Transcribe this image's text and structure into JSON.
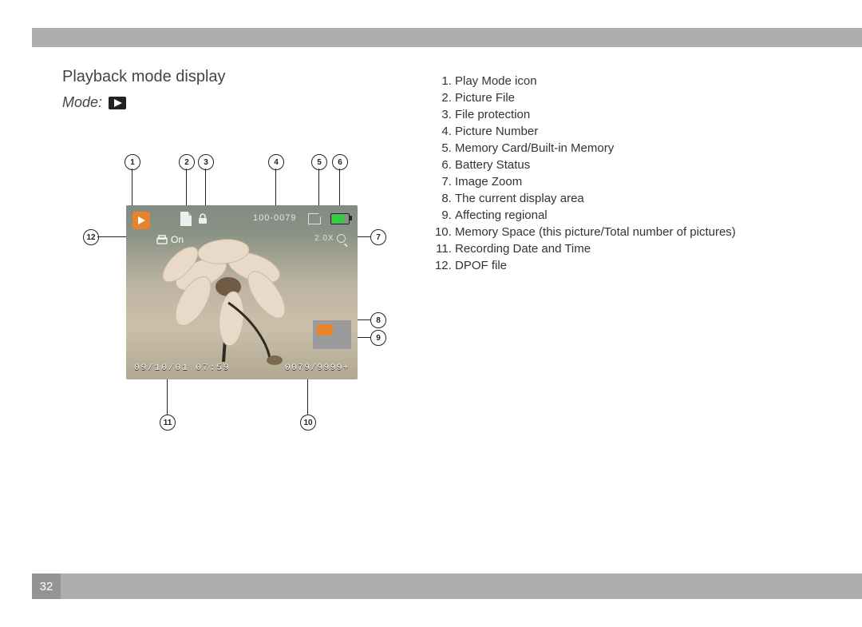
{
  "page_number": "32",
  "title": "Playback mode display",
  "mode_label": "Mode:",
  "overlays": {
    "picnum": "100-0079",
    "zoom": "2.0X",
    "dpof_label": "On",
    "datetime": "09/10/01  07:59",
    "memspace": "0079/9999+"
  },
  "legend": [
    "Play Mode icon",
    "Picture File",
    "File protection",
    "Picture Number",
    "Memory Card/Built-in Memory",
    "Battery Status",
    "Image Zoom",
    "The current display area",
    "Affecting regional",
    "Memory Space (this picture/Total number of pictures)",
    "Recording Date and Time",
    "DPOF file"
  ],
  "callout_numbers": [
    "1",
    "2",
    "3",
    "4",
    "5",
    "6",
    "7",
    "8",
    "9",
    "10",
    "11",
    "12"
  ]
}
